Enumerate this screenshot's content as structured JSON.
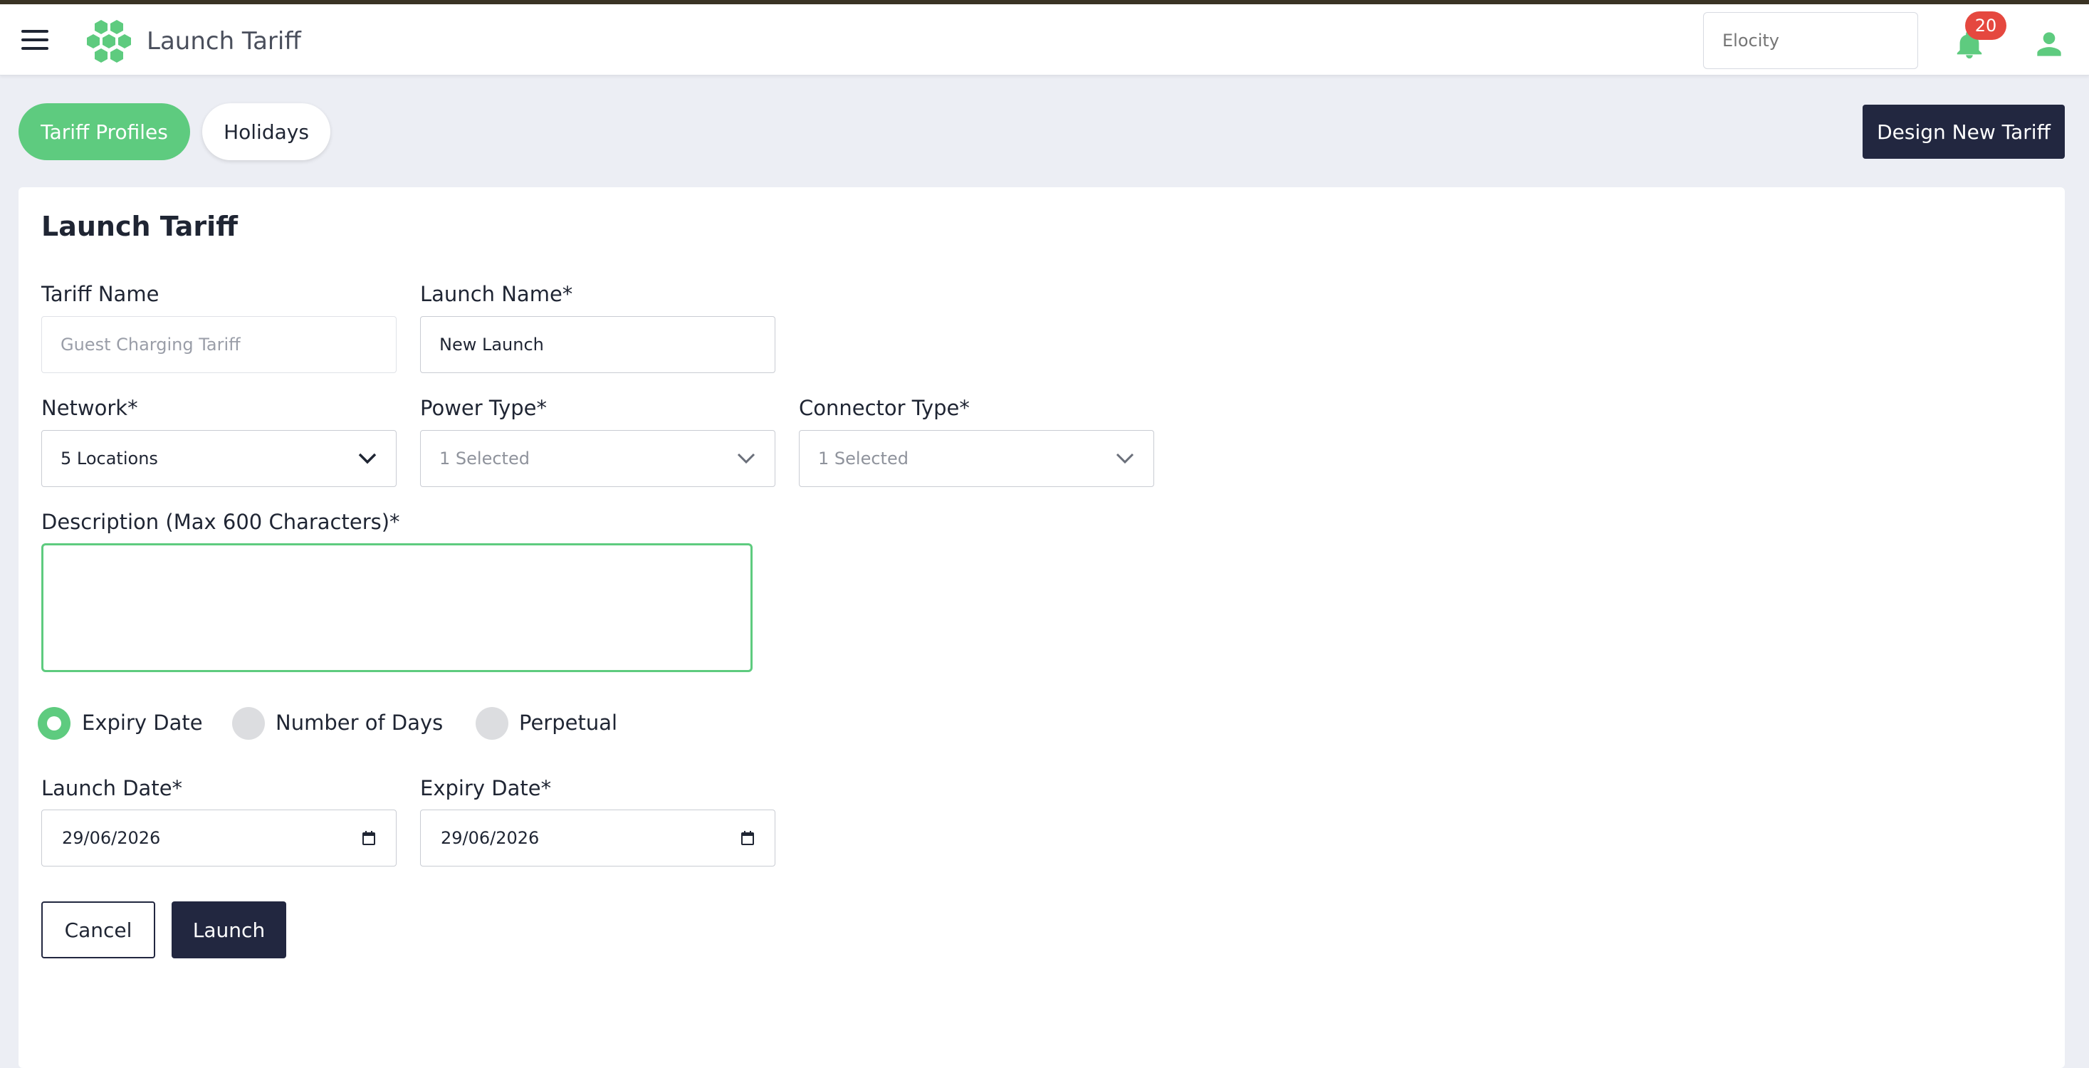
{
  "navbar": {
    "title": "Launch Tariff",
    "brand_select_value": "Elocity",
    "notification_count": "20",
    "accent_color": "#5ecb7f"
  },
  "tabs": [
    {
      "label": "Tariff Profiles",
      "active": true
    },
    {
      "label": "Holidays",
      "active": false
    }
  ],
  "design_button_label": "Design New Tariff",
  "form": {
    "title": "Launch Tariff",
    "tariff_name": {
      "label": "Tariff Name",
      "value": "Guest Charging Tariff"
    },
    "launch_name": {
      "label": "Launch Name*",
      "value": "New Launch"
    },
    "network": {
      "label": "Network*",
      "value": "5 Locations"
    },
    "power_type": {
      "label": "Power Type*",
      "value": "1 Selected"
    },
    "connector_type": {
      "label": "Connector Type*",
      "value": "1 Selected"
    },
    "description": {
      "label": "Description (Max 600 Characters)*",
      "value": ""
    },
    "validity_options": [
      {
        "label": "Expiry Date",
        "checked": true
      },
      {
        "label": "Number of Days",
        "checked": false
      },
      {
        "label": "Perpetual",
        "checked": false
      }
    ],
    "launch_date": {
      "label": "Launch Date*",
      "value": "29/06/2026"
    },
    "expiry_date": {
      "label": "Expiry Date*",
      "value": "29/06/2026"
    },
    "cancel_label": "Cancel",
    "launch_label": "Launch"
  }
}
